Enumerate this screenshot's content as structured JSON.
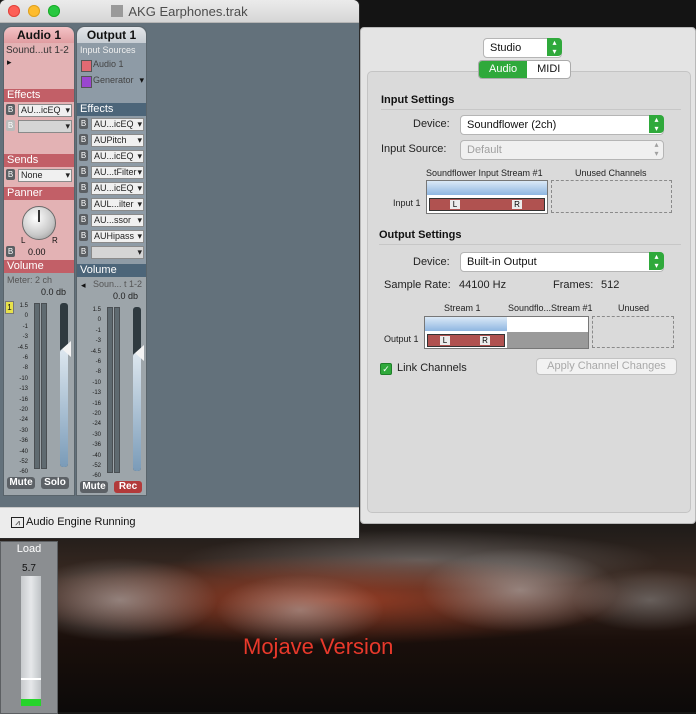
{
  "desktop": {
    "caption": "Mojave Version"
  },
  "mixer": {
    "title": "AKG Earphones.trak",
    "strips": [
      {
        "name": "Audio 1",
        "source": "Sound...ut 1-2",
        "play_marker": "▸",
        "effects_header": "Effects",
        "effects": [
          {
            "b": "B",
            "value": "AU...icEQ"
          },
          {
            "b": "B",
            "value": ""
          }
        ],
        "sends_header": "Sends",
        "sends": [
          {
            "b": "B",
            "value": "None"
          }
        ],
        "panner_header": "Panner",
        "pan_l": "L",
        "pan_r": "R",
        "pan_value": "0.00",
        "volume_header": "Volume",
        "meter_label": "Meter: 2 ch",
        "db_readout": "0.0 db",
        "channel_badge": "1",
        "mute": "Mute",
        "solo": "Solo"
      },
      {
        "name": "Output 1",
        "sources_header": "Input Sources",
        "sources": [
          {
            "name": "Audio 1",
            "color": "#e06a73"
          },
          {
            "name": "Generator",
            "color": "#9a47d0"
          }
        ],
        "effects_header": "Effects",
        "effects": [
          {
            "b": "B",
            "value": "AU...icEQ"
          },
          {
            "b": "B",
            "value": "AUPitch"
          },
          {
            "b": "B",
            "value": "AU...icEQ"
          },
          {
            "b": "B",
            "value": "AU...tFilter"
          },
          {
            "b": "B",
            "value": "AU...icEQ"
          },
          {
            "b": "B",
            "value": "AUL...ilter"
          },
          {
            "b": "B",
            "value": "AU...ssor"
          },
          {
            "b": "B",
            "value": "AUHipass"
          },
          {
            "b": "B",
            "value": ""
          }
        ],
        "volume_header": "Volume",
        "meter_label": "Soun... t 1-2",
        "db_readout": "0.0 db",
        "mute": "Mute",
        "rec": "Rec"
      }
    ],
    "meter_scale": [
      "1.5",
      "0",
      "-1",
      "-3",
      "-4.5",
      "-6",
      "-8",
      "-10",
      "-13",
      "-16",
      "-20",
      "-24",
      "-30",
      "-36",
      "-40",
      "-52",
      "-60"
    ],
    "status_text": "Audio Engine Running"
  },
  "settings": {
    "device_name": "Studio",
    "tabs": [
      {
        "label": "Audio",
        "selected": true
      },
      {
        "label": "MIDI",
        "selected": false
      }
    ],
    "input": {
      "title": "Input Settings",
      "device_label": "Device:",
      "device_value": "Soundflower (2ch)",
      "source_label": "Input Source:",
      "source_value": "Default",
      "stream_header": "Soundflower Input Stream #1",
      "unused_header": "Unused Channels",
      "row_label": "Input 1",
      "l": "L",
      "r": "R"
    },
    "output": {
      "title": "Output Settings",
      "device_label": "Device:",
      "device_value": "Built-in Output",
      "sample_rate_label": "Sample Rate:",
      "sample_rate_value": "44100 Hz",
      "frames_label": "Frames:",
      "frames_value": "512",
      "stream1_header": "Stream 1",
      "stream2_header": "Soundflo...Stream #1",
      "unused_header": "Unused",
      "row_label": "Output 1",
      "l": "L",
      "r": "R"
    },
    "link_channels": "Link Channels",
    "apply_button": "Apply Channel Changes"
  },
  "load": {
    "title": "Load",
    "value": "5.7",
    "level": 0.05,
    "peak": 0.2
  }
}
